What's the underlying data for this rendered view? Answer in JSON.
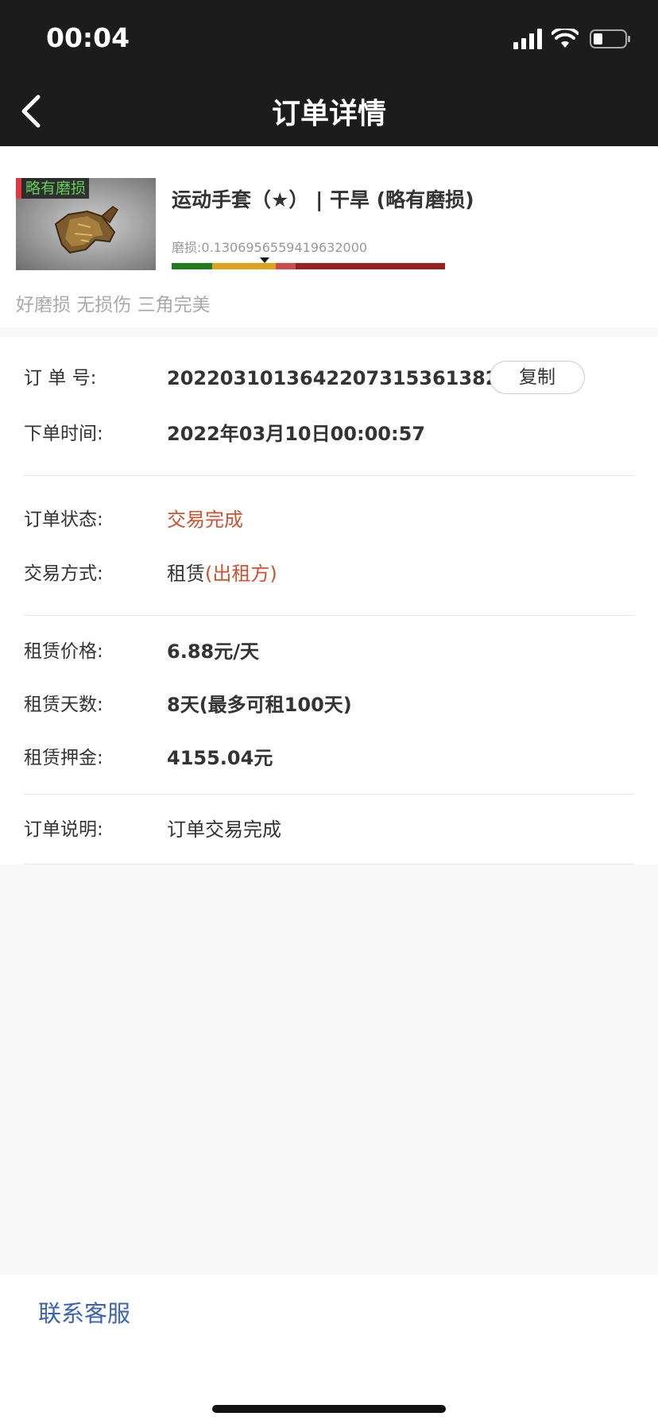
{
  "status_bar": {
    "time": "00:04"
  },
  "nav": {
    "title": "订单详情"
  },
  "item": {
    "wear_tag": "略有磨损",
    "name": "运动手套（★） | 干旱 (略有磨损)",
    "float_label": "磨损:0.1306956559419632000",
    "float_value": 0.1306956559419632,
    "tags": "好磨损 无损伤 三角完美",
    "wear_colors": [
      "#1e7b1e",
      "#e0a11c",
      "#cf4a4a",
      "#9a1f1f"
    ]
  },
  "order": {
    "order_no_label": "订  单  号:",
    "order_no": "20220310136422073153613824",
    "copy_label": "复制",
    "time_label": "下单时间:",
    "time": "2022年03月10日00:00:57",
    "status_label": "订单状态:",
    "status": "交易完成",
    "method_label": "交易方式:",
    "method": "租赁",
    "method_role": "(出租方)",
    "price_label": "租赁价格:",
    "price": "6.88元/天",
    "days_label": "租赁天数:",
    "days": "8天(最多可租100天)",
    "deposit_label": "租赁押金:",
    "deposit": "4155.04元",
    "note_label": "订单说明:",
    "note": "订单交易完成"
  },
  "footer": {
    "contact": "联系客服"
  },
  "colors": {
    "accent_red": "#d0512f",
    "link_blue": "#3b64b4",
    "header_bg": "#1c1c1d"
  }
}
